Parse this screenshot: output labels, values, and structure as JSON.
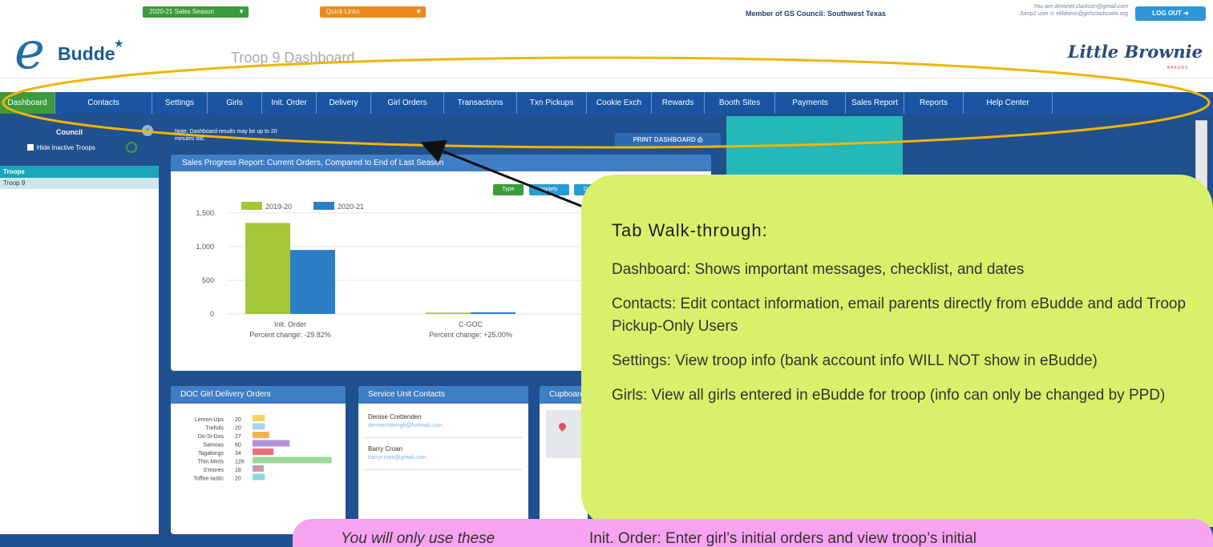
{
  "header": {
    "season_dropdown": "2020-21 Sales Season",
    "quick_links": "Quick Links",
    "council": "Member of GS Council: Southwest Texas",
    "user_line1": "You are devonet.clarkson@gmail.com",
    "user_line2": "Jump2 user is ebldvinis@girlscoutsswtx.org",
    "logout_label": "LOG OUT",
    "logo_e": "e",
    "logo_text": "Budde",
    "dashboard_title": "Troop 9 Dashboard",
    "brand_name": "Little Brownie",
    "brand_sub": "BAKERS",
    "colors": {
      "nav": "#1a55a2",
      "active_tab": "#3d9a3d",
      "accent": "#3f7ec4"
    }
  },
  "nav": {
    "tabs": [
      {
        "label": "Dashboard",
        "active": true
      },
      {
        "label": "Contacts"
      },
      {
        "label": "Settings"
      },
      {
        "label": "Girls"
      },
      {
        "label": "Init. Order"
      },
      {
        "label": "Delivery"
      },
      {
        "label": "Girl Orders"
      },
      {
        "label": "Transactions"
      },
      {
        "label": "Txn Pickups"
      },
      {
        "label": "Cookie Exch"
      },
      {
        "label": "Rewards"
      },
      {
        "label": "Booth Sites"
      },
      {
        "label": "Payments"
      },
      {
        "label": "Sales Report"
      },
      {
        "label": "Reports"
      },
      {
        "label": "Help Center"
      }
    ]
  },
  "sidebar": {
    "council_label": "Council",
    "hide_inactive": "Hide Inactive Troops",
    "troops_header": "Troops",
    "troops": [
      "Troop 9"
    ]
  },
  "dashboard": {
    "note": "Note: Dashboard results may be up to 20 minutes old.",
    "print_button": "PRINT DASHBOARD",
    "sales_title": "Sales Progress Report: Current Orders, Compared to End of Last Season",
    "view_buttons": [
      "Type",
      "Variety",
      "Dash"
    ]
  },
  "chart_data": [
    {
      "type": "bar",
      "title": "Sales Progress Report: Current Orders, Compared to End of Last Season",
      "categories": [
        "Init. Order",
        "C-GOC"
      ],
      "category_sublabels": [
        "Percent change: -29.82%",
        "Percent change: +25.00%"
      ],
      "series": [
        {
          "name": "2019-20",
          "color": "#a4c639",
          "values": [
            1350,
            20
          ]
        },
        {
          "name": "2020-21",
          "color": "#2c7fc6",
          "values": [
            950,
            25
          ]
        }
      ],
      "ylim": [
        0,
        1700
      ],
      "yticks": [
        "0",
        "500",
        "1,000",
        "1,500"
      ],
      "ytick_values": [
        0,
        500,
        1000,
        1500
      ],
      "legend": "top-left"
    },
    {
      "type": "bar",
      "orientation": "horizontal",
      "title": "DOC Girl Delivery Orders",
      "categories": [
        "Lemon-Ups",
        "Trefoils",
        "Do-Si-Dos",
        "Samoas",
        "Tagalongs",
        "Thin Mints",
        "S'mores",
        "Toffee-tastic"
      ],
      "values": [
        20,
        20,
        27,
        60,
        34,
        128,
        18,
        20
      ],
      "colors": [
        "#f2d35b",
        "#a8d4f0",
        "#f3b24e",
        "#b68fd8",
        "#ef6b7a",
        "#9ed89a",
        "#c79aa0",
        "#8fd6e0"
      ],
      "xlim": [
        0,
        135
      ]
    }
  ],
  "doc_card": {
    "title": "DOC Girl Delivery Orders"
  },
  "service_unit": {
    "title": "Service Unit Contacts",
    "contacts": [
      {
        "name": "Denise Crettenden",
        "email": "denisecrittengh@hotmail.com"
      },
      {
        "name": "Barry Croan",
        "email": "barrycroan@gmail.com"
      }
    ]
  },
  "cupboard": {
    "title": "Cupboard"
  },
  "callout": {
    "title": "Tab Walk-through:",
    "items": [
      {
        "term": "Dashboard:",
        "text": " Shows important messages, checklist, and dates"
      },
      {
        "term": "Contacts:",
        "text": " Edit contact information, email parents directly from eBudde and add Troop Pickup-Only Users"
      },
      {
        "term": "Settings:",
        "text": " View troop info (bank account info WILL NOT show in eBudde)"
      },
      {
        "term": "Girls:",
        "text": " View all girls entered in eBudde for troop (info can only be changed by PPD)"
      }
    ]
  },
  "pink_callout": {
    "left_text": "You will only use these",
    "right_text": "Init. Order: Enter girl’s initial orders and view troop’s initial"
  }
}
